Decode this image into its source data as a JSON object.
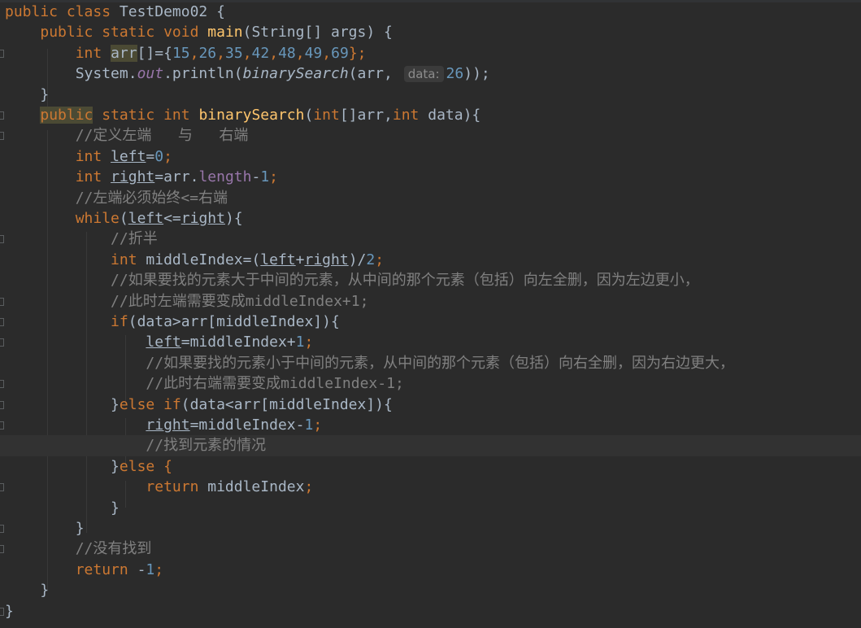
{
  "editor": {
    "theme_colors": {
      "background": "#2b2b2b",
      "keyword": "#cc7832",
      "function": "#ffc66d",
      "number": "#6897bb",
      "comment": "#808080",
      "field": "#9876aa",
      "text": "#a9b7c6"
    },
    "inlay_hint": "data:",
    "lines": [
      {
        "id": "l1",
        "tokens": [
          "public class ",
          "TestDemo02 {"
        ]
      },
      {
        "id": "l2",
        "tokens": [
          "public static void ",
          "main",
          "(String[] args) {"
        ]
      },
      {
        "id": "l3",
        "tokens": [
          "int ",
          "arr",
          "[]={",
          "15",
          ",",
          "26",
          ",",
          "35",
          ",",
          "42",
          ",",
          "48",
          ",",
          "49",
          ",",
          "69",
          "};"
        ]
      },
      {
        "id": "l4",
        "tokens": [
          "System.",
          "out",
          ".println(",
          "binarySearch",
          "(arr, ",
          "26",
          "));"
        ]
      },
      {
        "id": "l5",
        "tokens": [
          "}"
        ]
      },
      {
        "id": "l6",
        "tokens": [
          "public",
          " static int ",
          "binarySearch",
          "(",
          "int",
          "[]arr,",
          "int",
          " data){"
        ]
      },
      {
        "id": "l7",
        "tokens": [
          "//定义左端   与   右端"
        ]
      },
      {
        "id": "l8",
        "tokens": [
          "int ",
          "left",
          "=",
          "0",
          ";"
        ]
      },
      {
        "id": "l9",
        "tokens": [
          "int ",
          "right",
          "=arr.",
          "length",
          "-",
          "1",
          ";"
        ]
      },
      {
        "id": "l10",
        "tokens": [
          "//左端必须始终<=右端"
        ]
      },
      {
        "id": "l11",
        "tokens": [
          "while",
          "(",
          "left",
          "<=",
          "right",
          "){"
        ]
      },
      {
        "id": "l12",
        "tokens": [
          "//折半"
        ]
      },
      {
        "id": "l13",
        "tokens": [
          "int ",
          "middleIndex=(",
          "left",
          "+",
          "right",
          ")/",
          "2",
          ";"
        ]
      },
      {
        "id": "l14",
        "tokens": [
          "//如果要找的元素大于中间的元素，从中间的那个元素（包括）向左全删，因为左边更小，"
        ]
      },
      {
        "id": "l15",
        "tokens": [
          "//此时左端需要变成middleIndex+1;"
        ]
      },
      {
        "id": "l16",
        "tokens": [
          "if",
          "(data>arr[middleIndex]){"
        ]
      },
      {
        "id": "l17",
        "tokens": [
          "left",
          "=middleIndex+",
          "1",
          ";"
        ]
      },
      {
        "id": "l18",
        "tokens": [
          "//如果要找的元素小于中间的元素，从中间的那个元素（包括）向右全删，因为右边更大，"
        ]
      },
      {
        "id": "l19",
        "tokens": [
          "//此时右端需要变成middleIndex-1;"
        ]
      },
      {
        "id": "l20",
        "tokens": [
          "}",
          "else if",
          "(data<arr[middleIndex]){"
        ]
      },
      {
        "id": "l21",
        "tokens": [
          "right",
          "=middleIndex-",
          "1",
          ";"
        ]
      },
      {
        "id": "l22",
        "tokens": [
          "//找到元素的情况"
        ]
      },
      {
        "id": "l23",
        "tokens": [
          "}",
          "else {"
        ]
      },
      {
        "id": "l24",
        "tokens": [
          "return ",
          "middleIndex",
          ";"
        ]
      },
      {
        "id": "l25",
        "tokens": [
          "}"
        ]
      },
      {
        "id": "l26",
        "tokens": [
          "}"
        ]
      },
      {
        "id": "l27",
        "tokens": [
          "//没有找到"
        ]
      },
      {
        "id": "l28",
        "tokens": [
          "return ",
          "-",
          "1",
          ";"
        ]
      },
      {
        "id": "l29",
        "tokens": [
          "}"
        ]
      },
      {
        "id": "l30",
        "tokens": [
          "}"
        ]
      }
    ]
  }
}
